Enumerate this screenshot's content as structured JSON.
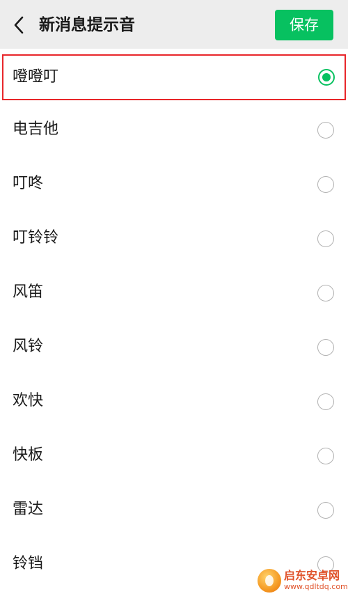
{
  "header": {
    "title": "新消息提示音",
    "save_label": "保存"
  },
  "tones": [
    {
      "label": "噔噔叮",
      "selected": true
    },
    {
      "label": "电吉他",
      "selected": false
    },
    {
      "label": "叮咚",
      "selected": false
    },
    {
      "label": "叮铃铃",
      "selected": false
    },
    {
      "label": "风笛",
      "selected": false
    },
    {
      "label": "风铃",
      "selected": false
    },
    {
      "label": "欢快",
      "selected": false
    },
    {
      "label": "快板",
      "selected": false
    },
    {
      "label": "雷达",
      "selected": false
    },
    {
      "label": "铃铛",
      "selected": false
    }
  ],
  "watermark": {
    "name": "启东安卓网",
    "url": "www.qdltdq.com"
  },
  "colors": {
    "accent": "#07c160",
    "highlight_border": "#e8262a",
    "header_bg": "#ededed"
  }
}
